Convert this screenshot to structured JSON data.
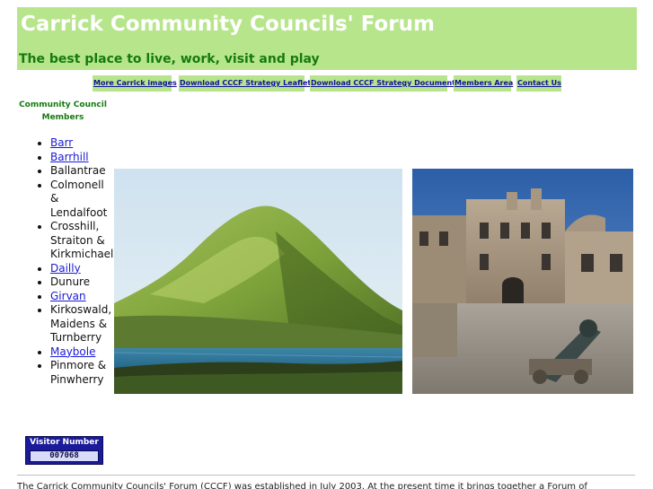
{
  "header": {
    "title": "Carrick Community Councils' Forum",
    "tagline": "The best place to live, work, visit and play",
    "background_color": "#b7e58c"
  },
  "nav": {
    "items": [
      {
        "label": "More Carrick images"
      },
      {
        "label": "Download CCCF Strategy Leaflet"
      },
      {
        "label": "Download CCCF Strategy Document"
      },
      {
        "label": "Members Area"
      },
      {
        "label": "Contact Us"
      }
    ]
  },
  "sidebar": {
    "heading_line1": "Community Council",
    "heading_line2": "Members",
    "members": [
      {
        "label": "Barr",
        "link": true
      },
      {
        "label": "Barrhill",
        "link": true
      },
      {
        "label": "Ballantrae",
        "link": false
      },
      {
        "label": "Colmonell & Lendalfoot",
        "link": false
      },
      {
        "label": "Crosshill, Straiton & Kirkmichael",
        "link": false
      },
      {
        "label": "Dailly",
        "link": true
      },
      {
        "label": "Dunure",
        "link": false
      },
      {
        "label": "Girvan",
        "link": true
      },
      {
        "label": "Kirkoswald, Maidens & Turnberry",
        "link": false
      },
      {
        "label": "Maybole",
        "link": true
      },
      {
        "label": "Pinmore & Pinwherry",
        "link": false
      }
    ]
  },
  "counter": {
    "label": "Visitor Number",
    "value": "007068"
  },
  "footer": {
    "text": "The Carrick Community Councils' Forum (CCCF) was established in July 2003. At the present time it brings together a Forum of"
  }
}
